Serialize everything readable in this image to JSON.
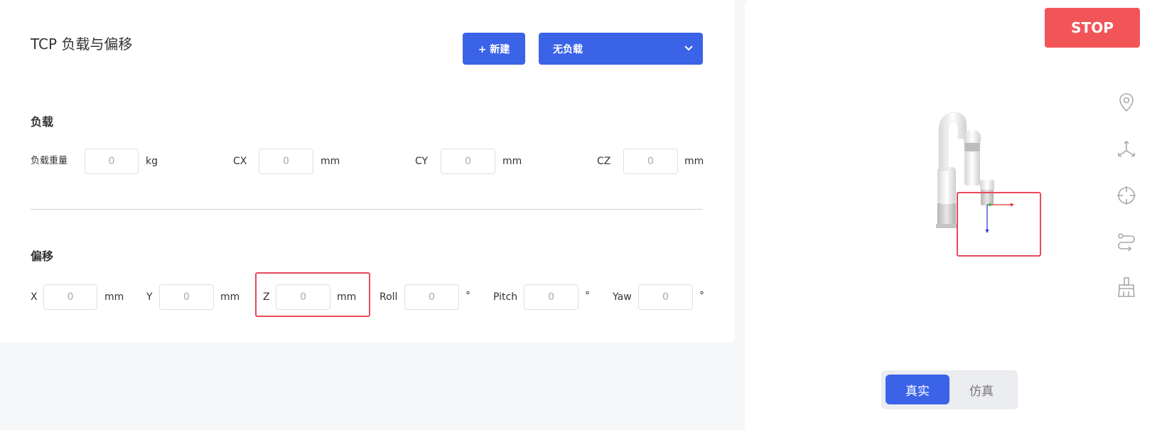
{
  "header": {
    "title": "TCP 负载与偏移",
    "new_button": "+ 新建",
    "load_select": {
      "value": "无负载"
    }
  },
  "load_section": {
    "title": "负载",
    "fields": [
      {
        "label": "负载重量",
        "value": "0",
        "unit": "kg"
      },
      {
        "label": "CX",
        "value": "0",
        "unit": "mm"
      },
      {
        "label": "CY",
        "value": "0",
        "unit": "mm"
      },
      {
        "label": "CZ",
        "value": "0",
        "unit": "mm"
      }
    ]
  },
  "offset_section": {
    "title": "偏移",
    "fields": [
      {
        "label": "X",
        "value": "0",
        "unit": "mm"
      },
      {
        "label": "Y",
        "value": "0",
        "unit": "mm"
      },
      {
        "label": "Z",
        "value": "0",
        "unit": "mm"
      },
      {
        "label": "Roll",
        "value": "0",
        "unit": "°"
      },
      {
        "label": "Pitch",
        "value": "0",
        "unit": "°"
      },
      {
        "label": "Yaw",
        "value": "0",
        "unit": "°"
      }
    ]
  },
  "stop_button": "STOP",
  "side_toolbar": [
    "location-pin-icon",
    "axes-3d-icon",
    "crosshair-icon",
    "path-icon",
    "brush-icon"
  ],
  "mode_toggle": {
    "active": "真实",
    "inactive": "仿真"
  },
  "colors": {
    "primary": "#3a63e8",
    "stop": "#f25557",
    "highlight": "#e8495b"
  }
}
